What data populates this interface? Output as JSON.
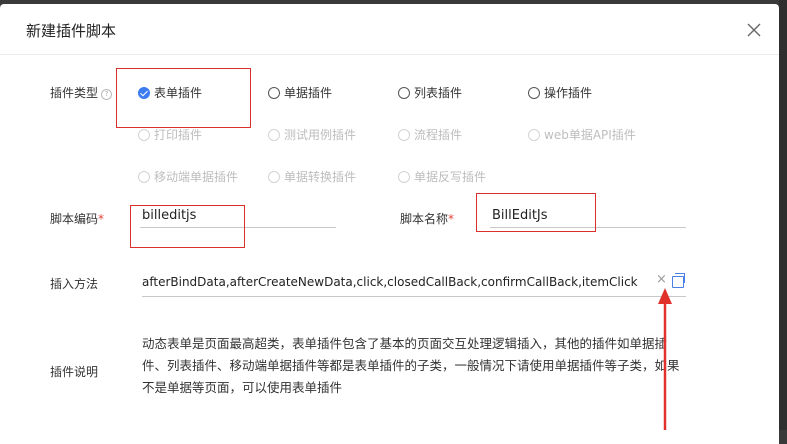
{
  "dialog": {
    "title": "新建插件脚本"
  },
  "plugin_type": {
    "label": "插件类型",
    "help": "?",
    "options": [
      {
        "label": "表单插件",
        "checked": true,
        "disabled": false
      },
      {
        "label": "单据插件",
        "checked": false,
        "disabled": false
      },
      {
        "label": "列表插件",
        "checked": false,
        "disabled": false
      },
      {
        "label": "操作插件",
        "checked": false,
        "disabled": false
      },
      {
        "label": "打印插件",
        "checked": false,
        "disabled": true
      },
      {
        "label": "测试用例插件",
        "checked": false,
        "disabled": true
      },
      {
        "label": "流程插件",
        "checked": false,
        "disabled": true
      },
      {
        "label": "web单据API插件",
        "checked": false,
        "disabled": true
      },
      {
        "label": "移动端单据插件",
        "checked": false,
        "disabled": true
      },
      {
        "label": "单据转换插件",
        "checked": false,
        "disabled": true
      },
      {
        "label": "单据反写插件",
        "checked": false,
        "disabled": true
      }
    ]
  },
  "script_code": {
    "label": "脚本编码",
    "required_mark": "*",
    "value": "billeditjs"
  },
  "script_name": {
    "label": "脚本名称",
    "required_mark": "*",
    "value": "BillEditJs"
  },
  "insert_method": {
    "label": "插入方法",
    "value": "afterBindData,afterCreateNewData,click,closedCallBack,confirmCallBack,itemClick",
    "clear_glyph": "×"
  },
  "plugin_desc": {
    "label": "插件说明",
    "text": "动态表单是页面最高超类，表单插件包含了基本的页面交互处理逻辑插入，其他的插件如单据插件、列表插件、移动端单据插件等都是表单插件的子类，一般情况下请使用单据插件等子类，如果不是单据等页面，可以使用表单插件"
  },
  "colors": {
    "accent": "#3d7cf0",
    "annotation": "#d9302c"
  }
}
